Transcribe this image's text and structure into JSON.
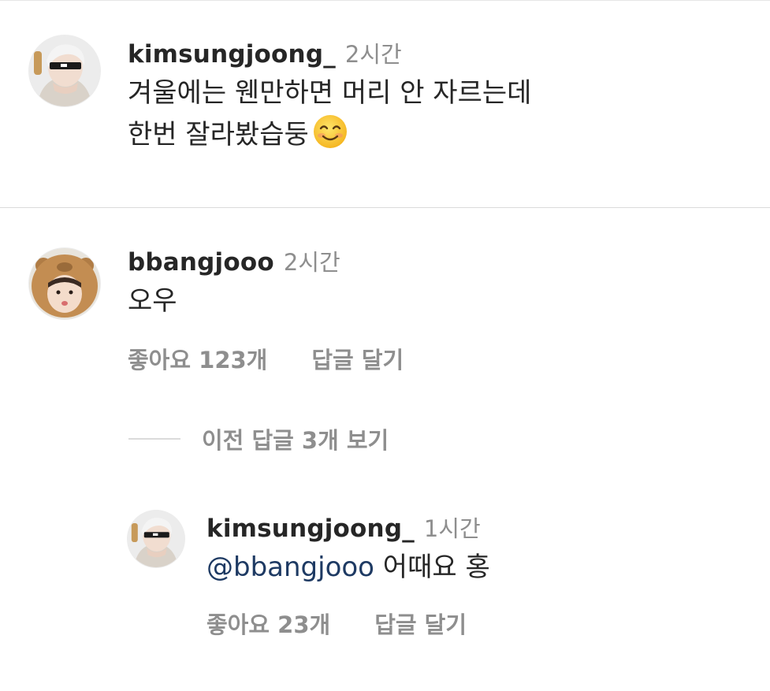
{
  "comments": [
    {
      "username": "kimsungjoong_",
      "time": "2시간",
      "line1": "겨울에는 웬만하면 머리 안 자르는데",
      "line2": "한번 잘라봤습둥",
      "emoji_icon": "smiling-face-icon"
    },
    {
      "username": "bbangjooo",
      "time": "2시간",
      "text": "오우",
      "likes": "좋아요 123개",
      "reply": "답글 달기"
    }
  ],
  "view_replies": "이전 답글 3개 보기",
  "reply": {
    "username": "kimsungjoong_",
    "time": "1시간",
    "mention": "@bbangjooo",
    "text": " 어때요 홍",
    "likes": "좋아요 23개",
    "reply_label": "답글 달기"
  },
  "colors": {
    "text": "#262626",
    "muted": "#8e8e8e",
    "mention": "#1e3a63",
    "divider": "#dbdbdb"
  }
}
